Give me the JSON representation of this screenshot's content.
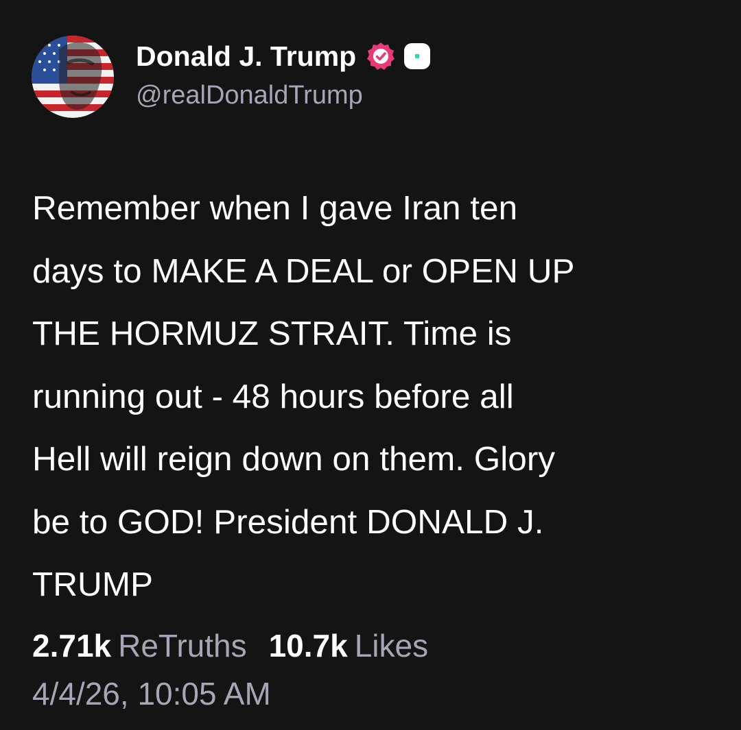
{
  "author": {
    "display_name": "Donald J. Trump",
    "handle": "@realDonaldTrump",
    "avatar_icon": "flag-portrait-avatar",
    "verified_icon": "verified-check-icon",
    "extra_badge_icon": "square-badge-icon"
  },
  "post": {
    "text": "Remember when I gave Iran ten\ndays to MAKE A DEAL or OPEN UP\nTHE HORMUZ STRAIT. Time is\nrunning out - 48 hours before all\nHell will reign down on them. Glory\nbe to GOD! President DONALD J.\nTRUMP"
  },
  "stats": {
    "retruths_count": "2.71k",
    "retruths_label": "ReTruths",
    "likes_count": "10.7k",
    "likes_label": "Likes"
  },
  "timestamp": "4/4/26, 10:05 AM",
  "colors": {
    "background": "#141414",
    "primary_text": "#ffffff",
    "secondary_text": "#a8a6b6",
    "verified_badge": "#e83a78",
    "accent_teal": "#2bd4b4"
  }
}
